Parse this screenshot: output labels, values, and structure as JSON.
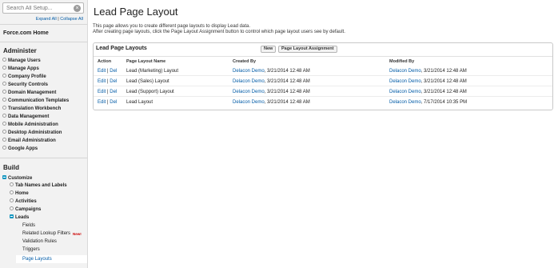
{
  "sidebar": {
    "search_placeholder": "Search All Setup...",
    "clear_icon": "×",
    "expand_all": "Expand All",
    "separator": "|",
    "collapse_all": "Collapse All",
    "home_link": "Force.com Home",
    "administer_title": "Administer",
    "administer_items": [
      "Manage Users",
      "Manage Apps",
      "Company Profile",
      "Security Controls",
      "Domain Management",
      "Communication Templates",
      "Translation Workbench",
      "Data Management",
      "Mobile Administration",
      "Desktop Administration",
      "Email Administration",
      "Google Apps"
    ],
    "build_title": "Build",
    "customize_label": "Customize",
    "customize_items": [
      "Tab Names and Labels",
      "Home",
      "Activities",
      "Campaigns"
    ],
    "leads_label": "Leads",
    "leads_items": [
      "Fields",
      "Related Lookup Filters",
      "Validation Rules",
      "Triggers"
    ],
    "new_badge": "New!",
    "active_item": "Page Layouts"
  },
  "main": {
    "title": "Lead Page Layout",
    "desc_line1": "This page allows you to create different page layouts to display Lead data.",
    "desc_line2": "After creating page layouts, click the Page Layout Assignment button to control which page layout users see by default."
  },
  "panel": {
    "title": "Lead Page Layouts",
    "new_button": "New",
    "assignment_button": "Page Layout Assignment",
    "headers": {
      "action": "Action",
      "name": "Page Layout Name",
      "created": "Created By",
      "modified": "Modified By"
    },
    "edit_label": "Edit",
    "action_sep": "|",
    "del_label": "Del",
    "rows": [
      {
        "name": "Lead (Marketing) Layout",
        "created_user": "Delacon Demo",
        "created_date": ", 3/21/2014 12:48 AM",
        "modified_user": "Delacon Demo",
        "modified_date": ", 3/21/2014 12:48 AM"
      },
      {
        "name": "Lead (Sales) Layout",
        "created_user": "Delacon Demo",
        "created_date": ", 3/21/2014 12:48 AM",
        "modified_user": "Delacon Demo",
        "modified_date": ", 3/21/2014 12:48 AM"
      },
      {
        "name": "Lead (Support) Layout",
        "created_user": "Delacon Demo",
        "created_date": ", 3/21/2014 12:48 AM",
        "modified_user": "Delacon Demo",
        "modified_date": ", 3/21/2014 12:48 AM"
      },
      {
        "name": "Lead Layout",
        "created_user": "Delacon Demo",
        "created_date": ", 3/21/2014 12:48 AM",
        "modified_user": "Delacon Demo",
        "modified_date": ", 7/17/2014 10:35 PM"
      }
    ]
  },
  "colors": {
    "link": "#015ba7",
    "accent": "#1797c0",
    "badge": "#cc0000"
  }
}
